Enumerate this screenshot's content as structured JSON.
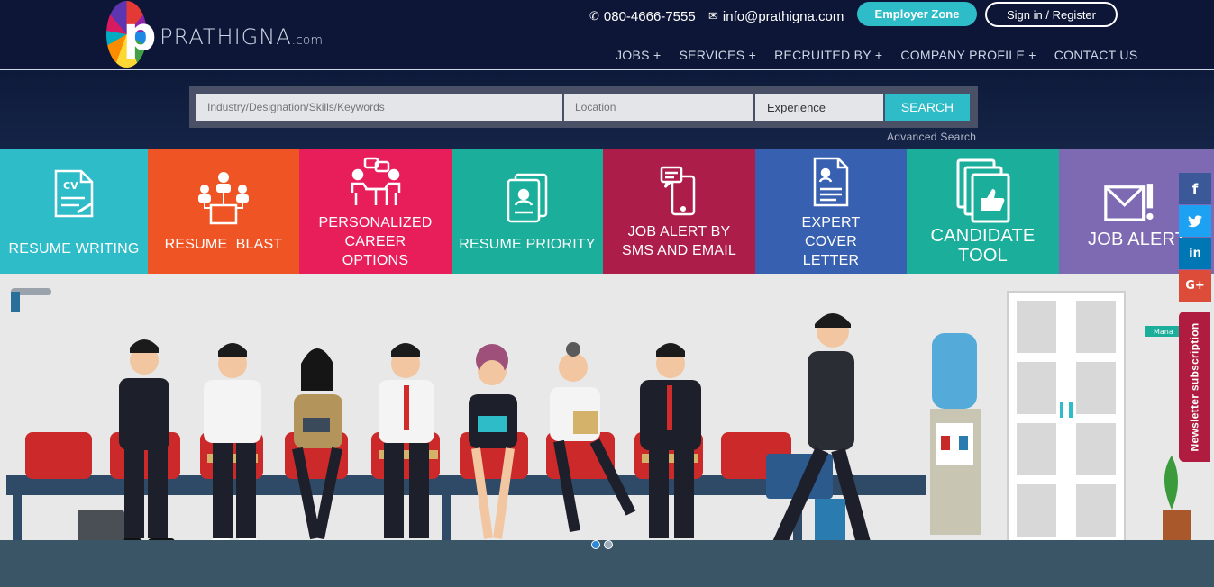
{
  "header": {
    "logo_text": "PRATHIGNA",
    "logo_suffix": ".com",
    "phone": "080-4666-7555",
    "email": "info@prathigna.com",
    "employer_zone": "Employer Zone",
    "signin": "Sign in / Register",
    "nav": [
      "JOBS +",
      "SERVICES +",
      "RECRUITED BY +",
      "COMPANY PROFILE +",
      "CONTACT US"
    ]
  },
  "search": {
    "keywords_placeholder": "Industry/Designation/Skills/Keywords",
    "location_placeholder": "Location",
    "experience": "Experience",
    "button": "SEARCH",
    "advanced": "Advanced Search"
  },
  "tiles": [
    {
      "label": "RESUME WRITING",
      "color": "#2ebcc9",
      "icon": "cv-document-icon"
    },
    {
      "label": "RESUME  BLAST",
      "color": "#ef5424",
      "icon": "team-network-icon"
    },
    {
      "label": "PERSONALIZED CAREER OPTIONS",
      "color": "#e81e5b",
      "icon": "meeting-chat-icon"
    },
    {
      "label": "RESUME PRIORITY",
      "color": "#1aae9b",
      "icon": "profile-cards-icon"
    },
    {
      "label": "JOB ALERT BY SMS AND EMAIL",
      "color": "#ad1d4a",
      "icon": "mobile-message-icon"
    },
    {
      "label": "EXPERT COVER LETTER",
      "color": "#3860b0",
      "icon": "profile-document-icon"
    },
    {
      "label": "CANDIDATE TOOL",
      "color": "#1aae9b",
      "icon": "thumbs-up-cards-icon"
    },
    {
      "label": "JOB ALERT",
      "color": "#7e69b3",
      "icon": "mail-alert-icon"
    }
  ],
  "social": [
    {
      "name": "facebook",
      "glyph": "f",
      "color": "#3b5998"
    },
    {
      "name": "twitter",
      "glyph": "t",
      "color": "#1da1f2"
    },
    {
      "name": "linkedin",
      "glyph": "in",
      "color": "#0077b5"
    },
    {
      "name": "googleplus",
      "glyph": "G+",
      "color": "#dd4b39"
    }
  ],
  "newsletter": "Newsletter subscription",
  "hero": {
    "sign_text": "Mana",
    "slides": 2,
    "active_slide": 1
  }
}
